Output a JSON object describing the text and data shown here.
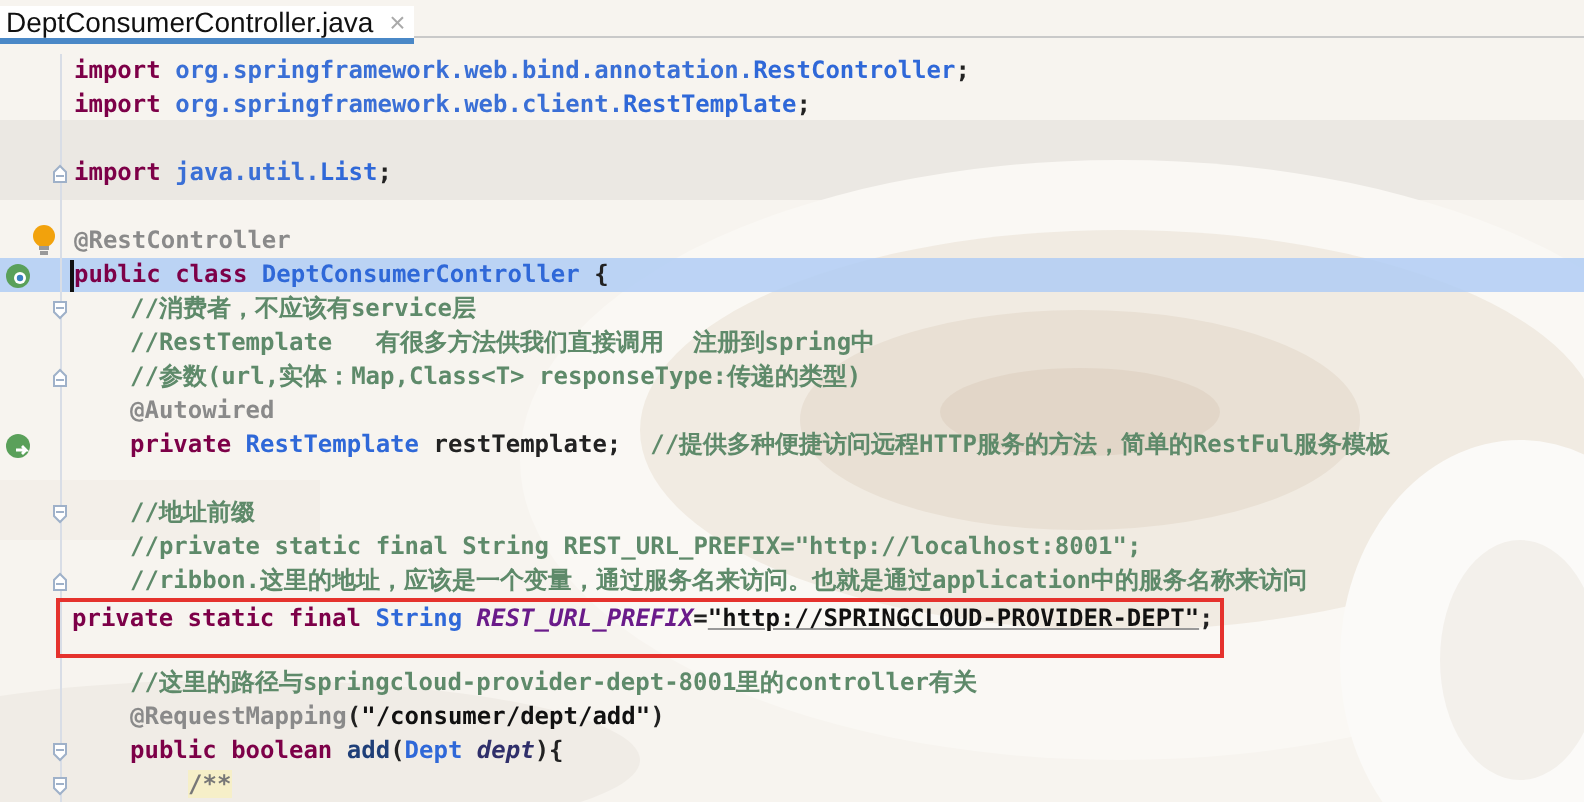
{
  "tab": {
    "label": "DeptConsumerController.java",
    "close": "×",
    "selected": true
  },
  "lines": [
    {
      "kind": "top",
      "tokens": [
        {
          "kind": "kw",
          "text": "import"
        },
        {
          "kind": "pkg",
          "text": " org.springframework.web.bind.annotation."
        },
        {
          "kind": "cls",
          "text": "RestController"
        },
        {
          "kind": "pl",
          "text": ";"
        }
      ]
    },
    {
      "kind": "top",
      "tokens": [
        {
          "kind": "kw",
          "text": "import"
        },
        {
          "kind": "pkg",
          "text": " org.springframework.web.client."
        },
        {
          "kind": "cls",
          "text": "RestTemplate"
        },
        {
          "kind": "pl",
          "text": ";"
        }
      ]
    },
    {
      "kind": "blank"
    },
    {
      "kind": "top",
      "fold_end": true,
      "tokens": [
        {
          "kind": "kw",
          "text": "import"
        },
        {
          "kind": "pkg",
          "text": " java.util."
        },
        {
          "kind": "cls",
          "text": "List"
        },
        {
          "kind": "pl",
          "text": ";"
        }
      ]
    },
    {
      "kind": "blank"
    },
    {
      "kind": "top",
      "bulb": true,
      "tokens": [
        {
          "kind": "ann",
          "text": "@RestController"
        }
      ]
    },
    {
      "kind": "top",
      "highlighted": true,
      "bean": true,
      "caret": true,
      "tokens": [
        {
          "kind": "kw",
          "text": "public class "
        },
        {
          "kind": "cls",
          "text": "DeptConsumerController"
        },
        {
          "kind": "pl",
          "text": " {"
        }
      ]
    },
    {
      "kind": "member",
      "fold_start": true,
      "tokens": [
        {
          "kind": "cm",
          "text": "//消费者，不应该有service层"
        }
      ]
    },
    {
      "kind": "member",
      "tokens": [
        {
          "kind": "cm",
          "text": "//RestTemplate   有很多方法供我们直接调用  注册到spring中"
        }
      ]
    },
    {
      "kind": "member",
      "fold_end": true,
      "tokens": [
        {
          "kind": "cm",
          "text": "//参数(url,实体：Map,Class<T> responseType:传递的类型)"
        }
      ]
    },
    {
      "kind": "member",
      "tokens": [
        {
          "kind": "ann",
          "text": "@Autowired"
        }
      ]
    },
    {
      "kind": "member",
      "autowired": true,
      "tokens": [
        {
          "kind": "kw",
          "text": "private "
        },
        {
          "kind": "cls",
          "text": "RestTemplate"
        },
        {
          "kind": "pl",
          "text": " restTemplate;  "
        },
        {
          "kind": "cm",
          "text": "//提供多种便捷访问远程HTTP服务的方法，简单的RestFul服务模板"
        }
      ]
    },
    {
      "kind": "blank"
    },
    {
      "kind": "member",
      "fold_start": true,
      "tokens": [
        {
          "kind": "cm",
          "text": "//地址前缀"
        }
      ]
    },
    {
      "kind": "member",
      "tokens": [
        {
          "kind": "cm",
          "text": "//private static final String REST_URL_PREFIX=\"http://localhost:8001\";"
        }
      ]
    },
    {
      "kind": "member",
      "fold_end": true,
      "tokens": [
        {
          "kind": "cm",
          "text": "//ribbon.这里的地址，应该是一个变量，通过服务名来访问。也就是通过application中的服务名称来访问"
        }
      ]
    },
    {
      "kind": "member",
      "boxed": true,
      "tokens": [
        {
          "kind": "kw",
          "text": "private static final "
        },
        {
          "kind": "cls",
          "text": "String "
        },
        {
          "kind": "fld",
          "text": "REST_URL_PREFIX"
        },
        {
          "kind": "pl",
          "text": "="
        },
        {
          "kind": "str",
          "text": "\"http://SPRINGCLOUD-PROVIDER-DEPT\""
        },
        {
          "kind": "pl",
          "text": ";"
        }
      ]
    },
    {
      "kind": "member",
      "tokens": [
        {
          "kind": "cm",
          "text": "//这里的路径与springcloud-provider-dept-8001里的controller有关"
        }
      ]
    },
    {
      "kind": "member",
      "tokens": [
        {
          "kind": "ann",
          "text": "@RequestMapping"
        },
        {
          "kind": "pl",
          "text": "("
        },
        {
          "kind": "str2",
          "text": "\"/consumer/dept/add\""
        },
        {
          "kind": "pl",
          "text": ")"
        }
      ]
    },
    {
      "kind": "member",
      "fold_start": true,
      "tokens": [
        {
          "kind": "kw",
          "text": "public boolean "
        },
        {
          "kind": "mth",
          "text": "add"
        },
        {
          "kind": "pl",
          "text": "("
        },
        {
          "kind": "cls",
          "text": "Dept "
        },
        {
          "kind": "prm",
          "text": "dept"
        },
        {
          "kind": "pl",
          "text": "){"
        }
      ]
    },
    {
      "kind": "body",
      "fold_start": true,
      "tokens": [
        {
          "kind": "doc",
          "text": "/**"
        }
      ]
    }
  ]
}
